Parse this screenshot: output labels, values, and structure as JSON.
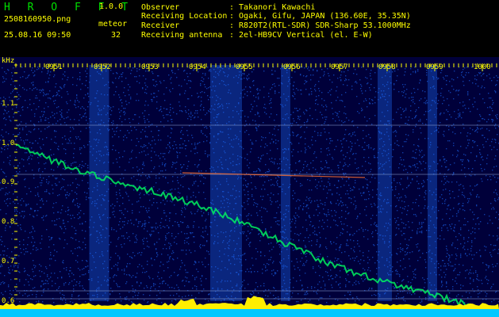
{
  "header": {
    "app_name": "H R O F F T",
    "version": "1.0.0",
    "filename": "2508160950.png",
    "event_label": "meteor",
    "datetime": "25.08.16 09:50",
    "event_count": "32",
    "meta": [
      {
        "key": "Observer",
        "value": ": Takanori Kawachi"
      },
      {
        "key": "Receiving Location",
        "value": ": Ogaki, Gifu, JAPAN (136.60E, 35.35N)"
      },
      {
        "key": "Receiver",
        "value": ": R820T2(RTL-SDR) SDR-Sharp 53.1000MHz"
      },
      {
        "key": "Receiving antenna",
        "value": ": 2el-HB9CV Vertical (el. E-W)"
      }
    ]
  },
  "spectrogram": {
    "y_unit": "kHz",
    "y_ticks": [
      "1.1",
      "1.0",
      "0.9",
      "0.8",
      "0.7",
      "0.6"
    ],
    "x_ticks": [
      "0951",
      "0952",
      "0953",
      "0954",
      "0955",
      "0956",
      "0957",
      "0958",
      "0959",
      "1000"
    ],
    "colors": {
      "background": "#00003a",
      "noise": "#1e6cff",
      "signal": "#00ff60",
      "ticks": "#ffff00",
      "baseline": "#ffee00",
      "floor": "#00c8ff"
    }
  }
}
